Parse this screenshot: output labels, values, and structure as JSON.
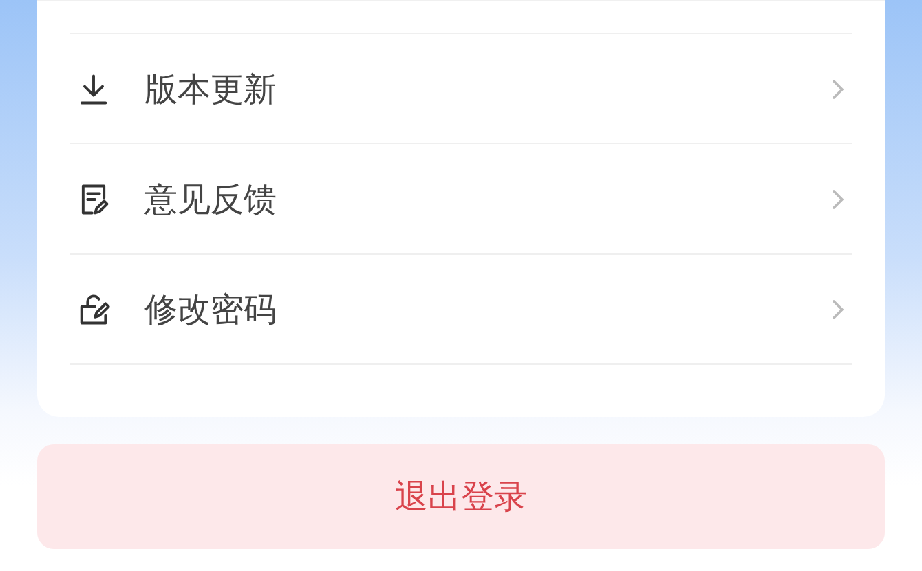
{
  "menu_items": [
    {
      "kind": "download",
      "label": "版本更新"
    },
    {
      "kind": "feedback",
      "label": "意见反馈"
    },
    {
      "kind": "lock",
      "label": "修改密码"
    }
  ],
  "logout_button": {
    "label": "退出登录"
  }
}
